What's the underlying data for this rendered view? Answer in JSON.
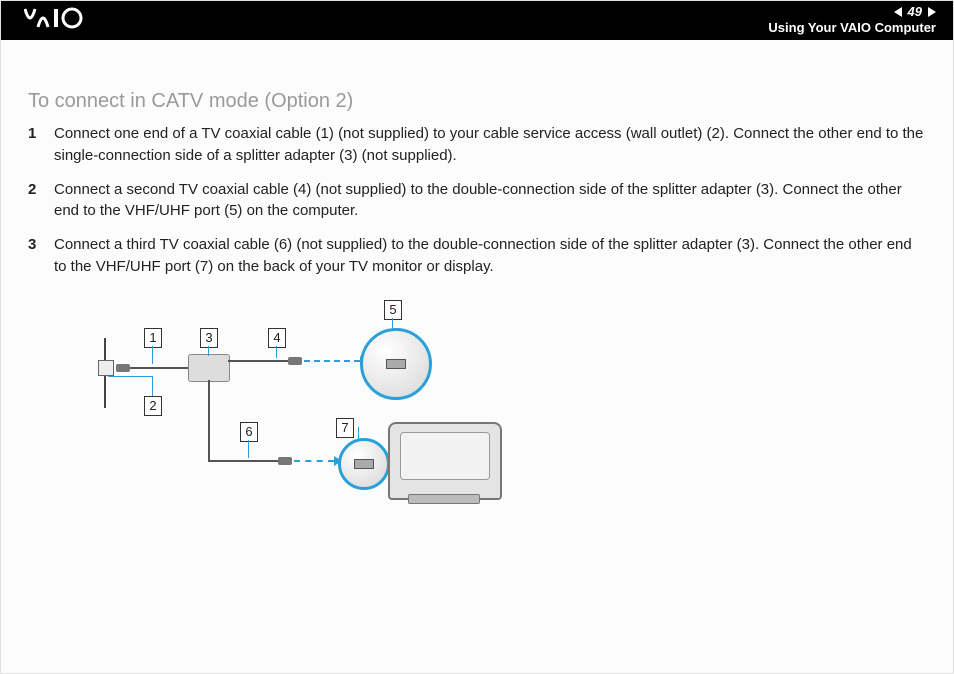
{
  "header": {
    "page_number": "49",
    "section_title": "Using Your VAIO Computer"
  },
  "section": {
    "title": "To connect in CATV mode (Option 2)",
    "steps": [
      "Connect one end of a TV coaxial cable (1) (not supplied) to your cable service access (wall outlet) (2). Connect the other end to the single-connection side of a splitter adapter (3) (not supplied).",
      "Connect a second TV coaxial cable (4) (not supplied) to the double-connection side of the splitter adapter (3). Connect the other end to the VHF/UHF port (5) on the computer.",
      "Connect a third TV coaxial cable (6) (not supplied) to the double-connection side of the splitter adapter (3). Connect the other end to the VHF/UHF port (7) on the back of your TV monitor or display."
    ]
  },
  "diagram": {
    "callouts": {
      "c1": "1",
      "c2": "2",
      "c3": "3",
      "c4": "4",
      "c5": "5",
      "c6": "6",
      "c7": "7"
    }
  }
}
